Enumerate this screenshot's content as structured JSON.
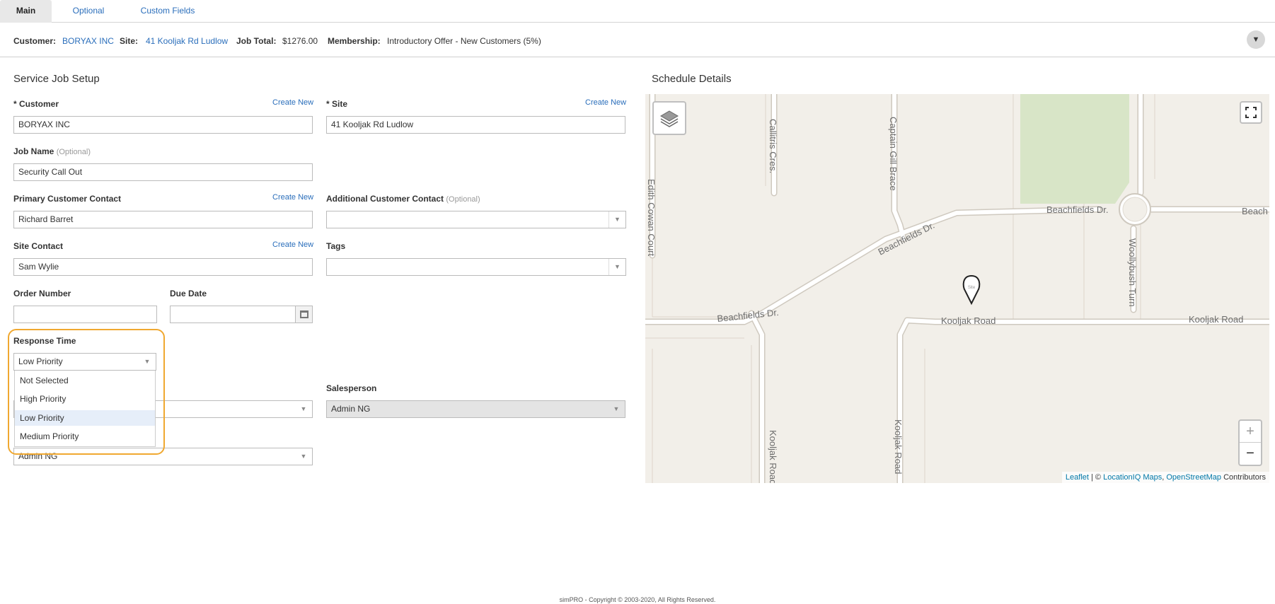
{
  "tabs": [
    {
      "label": "Main",
      "active": true
    },
    {
      "label": "Optional",
      "active": false
    },
    {
      "label": "Custom Fields",
      "active": false
    }
  ],
  "summary": {
    "customer_label": "Customer:",
    "customer_value": "BORYAX INC",
    "site_label": "Site:",
    "site_value": "41 Kooljak Rd Ludlow",
    "job_total_label": "Job Total:",
    "job_total_value": "$1276.00",
    "membership_label": "Membership:",
    "membership_value": "Introductory Offer - New Customers (5%)"
  },
  "setup": {
    "title": "Service Job Setup",
    "create_new": "Create New",
    "customer": {
      "label": "* Customer",
      "value": "BORYAX INC"
    },
    "site": {
      "label": "* Site",
      "value": "41 Kooljak Rd Ludlow"
    },
    "job_name": {
      "label": "Job Name",
      "optional": "(Optional)",
      "value": "Security Call Out"
    },
    "primary_contact": {
      "label": "Primary Customer Contact",
      "value": "Richard Barret"
    },
    "additional_contact": {
      "label": "Additional Customer Contact",
      "optional": "(Optional)",
      "value": ""
    },
    "site_contact": {
      "label": "Site Contact",
      "value": "Sam Wylie"
    },
    "tags": {
      "label": "Tags",
      "value": ""
    },
    "order_number": {
      "label": "Order Number",
      "value": ""
    },
    "due_date": {
      "label": "Due Date",
      "value": ""
    },
    "response_time": {
      "label": "Response Time",
      "value": "Low Priority",
      "options": [
        "Not Selected",
        "High Priority",
        "Low Priority",
        "Medium Priority"
      ],
      "selected_index": 2
    },
    "salesperson": {
      "label": "Salesperson",
      "value": "Admin NG"
    },
    "hidden_select_value": "",
    "technician_value": "Admin NG"
  },
  "schedule": {
    "title": "Schedule Details",
    "streets": {
      "edith": "Edith Cowan Court",
      "calitris": "Callitris Cres.",
      "captain": "Captain Gill Brace",
      "beach_dr_1": "Beachfields Dr.",
      "beach_dr_2": "Beachfields Dr.",
      "beach_dr_3": "Beachfields Dr.",
      "beach_edge": "Beach",
      "wooly": "Woollybush Turn",
      "kooljak_1": "Kooljak Road",
      "kooljak_2": "Kooljak Road",
      "kooljak_v1": "Kooljak Road",
      "kooljak_v2": "Kooljak Road"
    },
    "marker_label": "Site",
    "zoom_in": "+",
    "zoom_out": "−",
    "attribution": {
      "leaflet": "Leaflet",
      "sep": " | © ",
      "locationiq": "LocationIQ Maps",
      "comma": ", ",
      "osm": "OpenStreetMap",
      "contributors": " Contributors"
    }
  },
  "footer": "simPRO - Copyright © 2003-2020, All Rights Reserved."
}
